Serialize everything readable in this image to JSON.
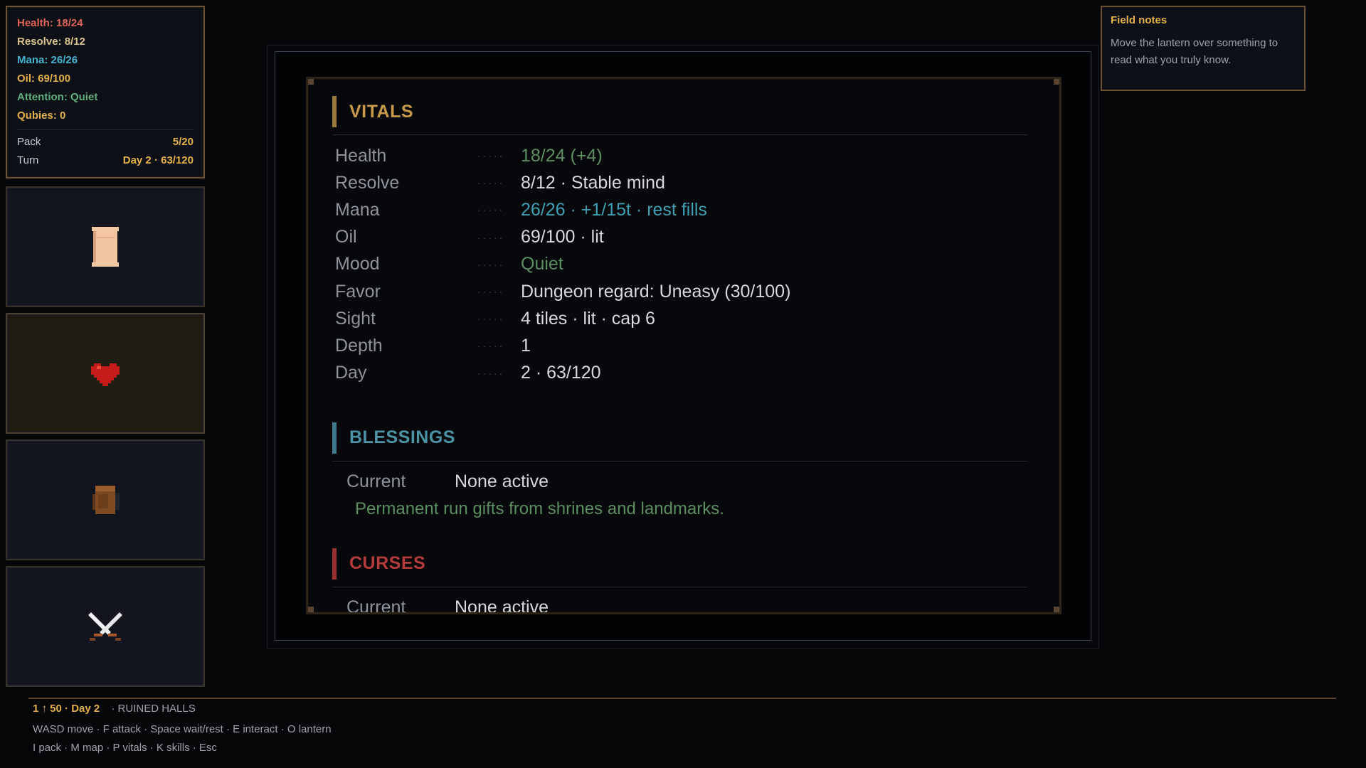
{
  "stats": {
    "lines": [
      {
        "text": "Health: 18/24",
        "color": "#e0645a"
      },
      {
        "text": "Resolve: 8/12",
        "color": "#d9c38a"
      },
      {
        "text": "Mana: 26/26",
        "color": "#43b3cf"
      },
      {
        "text": "Oil: 69/100",
        "color": "#e3b04a"
      },
      {
        "text": "Attention: Quiet",
        "color": "#5fae7c"
      },
      {
        "text": "Qubies: 0",
        "color": "#e3b04a"
      }
    ],
    "pack_label": "Pack",
    "pack_value": "5/20",
    "turn_label": "Turn",
    "turn_value": "Day 2 · 63/120"
  },
  "slots": [
    {
      "icon": "scroll-icon",
      "active": false
    },
    {
      "icon": "heart-icon",
      "active": true
    },
    {
      "icon": "backpack-icon",
      "active": false
    },
    {
      "icon": "crossed-swords-icon",
      "active": false
    }
  ],
  "vitals": {
    "title": "VITALS",
    "rows": [
      {
        "label": "Health",
        "value": "18/24 (+4)",
        "tone": "green"
      },
      {
        "label": "Resolve",
        "value": "8/12 · Stable mind",
        "tone": ""
      },
      {
        "label": "Mana",
        "value": "26/26 · +1/15t · rest fills",
        "tone": "teal"
      },
      {
        "label": "Oil",
        "value": "69/100 · lit",
        "tone": ""
      },
      {
        "label": "Mood",
        "value": "Quiet",
        "tone": "green"
      },
      {
        "label": "Favor",
        "value": "Dungeon regard: Uneasy (30/100)",
        "tone": ""
      },
      {
        "label": "Sight",
        "value": "4 tiles · lit · cap 6",
        "tone": ""
      },
      {
        "label": "Depth",
        "value": "1",
        "tone": ""
      },
      {
        "label": "Day",
        "value": "2 · 63/120",
        "tone": ""
      }
    ],
    "dots": "·····"
  },
  "blessings": {
    "title": "BLESSINGS",
    "current_label": "Current",
    "current_value": "None active",
    "description": "Permanent run gifts from shrines and landmarks."
  },
  "curses": {
    "title": "CURSES",
    "current_label": "Current",
    "current_value": "None active"
  },
  "field_notes": {
    "title": "Field notes",
    "body": "Move the lantern over something to read what you truly know."
  },
  "status_bar": {
    "position": "1 ↑ 50 · Day 2",
    "location": "· RUINED HALLS",
    "hint1": "WASD move · F attack · Space wait/rest · E interact · O lantern",
    "hint2": "I pack · M map · P vitals · K skills · Esc"
  }
}
